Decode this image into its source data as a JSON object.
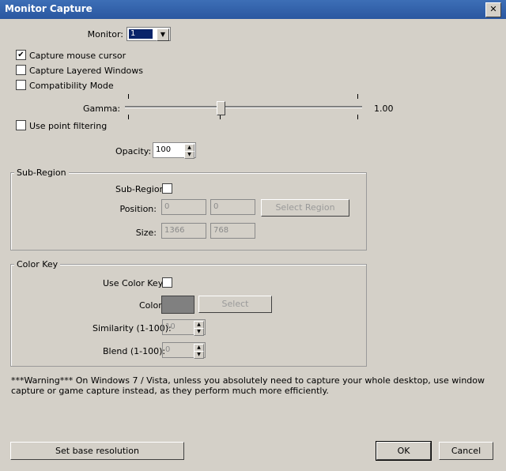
{
  "window": {
    "title": "Monitor Capture",
    "close_glyph": "✕"
  },
  "monitor": {
    "label": "Monitor:",
    "value": "1"
  },
  "options": {
    "capture_mouse": {
      "label": "Capture mouse cursor",
      "checked": true
    },
    "capture_layered": {
      "label": "Capture Layered Windows",
      "checked": false
    },
    "compatibility": {
      "label": "Compatibility Mode",
      "checked": false
    },
    "point_filtering": {
      "label": "Use point filtering",
      "checked": false
    }
  },
  "gamma": {
    "label": "Gamma:",
    "value": "1.00"
  },
  "opacity": {
    "label": "Opacity:",
    "value": "100"
  },
  "sub_region": {
    "group_label": "Sub-Region",
    "enable_label": "Sub-Region",
    "position_label": "Position:",
    "position_x": "0",
    "position_y": "0",
    "select_button": "Select Region",
    "size_label": "Size:",
    "width": "1366",
    "height": "768"
  },
  "color_key": {
    "group_label": "Color Key",
    "use_label": "Use Color Key:",
    "color_label": "Color",
    "color_value": "#808080",
    "select_button": "Select",
    "similarity_label": "Similarity (1-100):",
    "similarity_value": "10",
    "blend_label": "Blend (1-100):",
    "blend_value": "0"
  },
  "warning": "***Warning*** On Windows 7 / Vista, unless you absolutely need to capture your whole desktop, use window capture or game capture instead, as they perform much more efficiently.",
  "footer": {
    "base_resolution_button": "Set base resolution",
    "ok_button": "OK",
    "cancel_button": "Cancel"
  }
}
